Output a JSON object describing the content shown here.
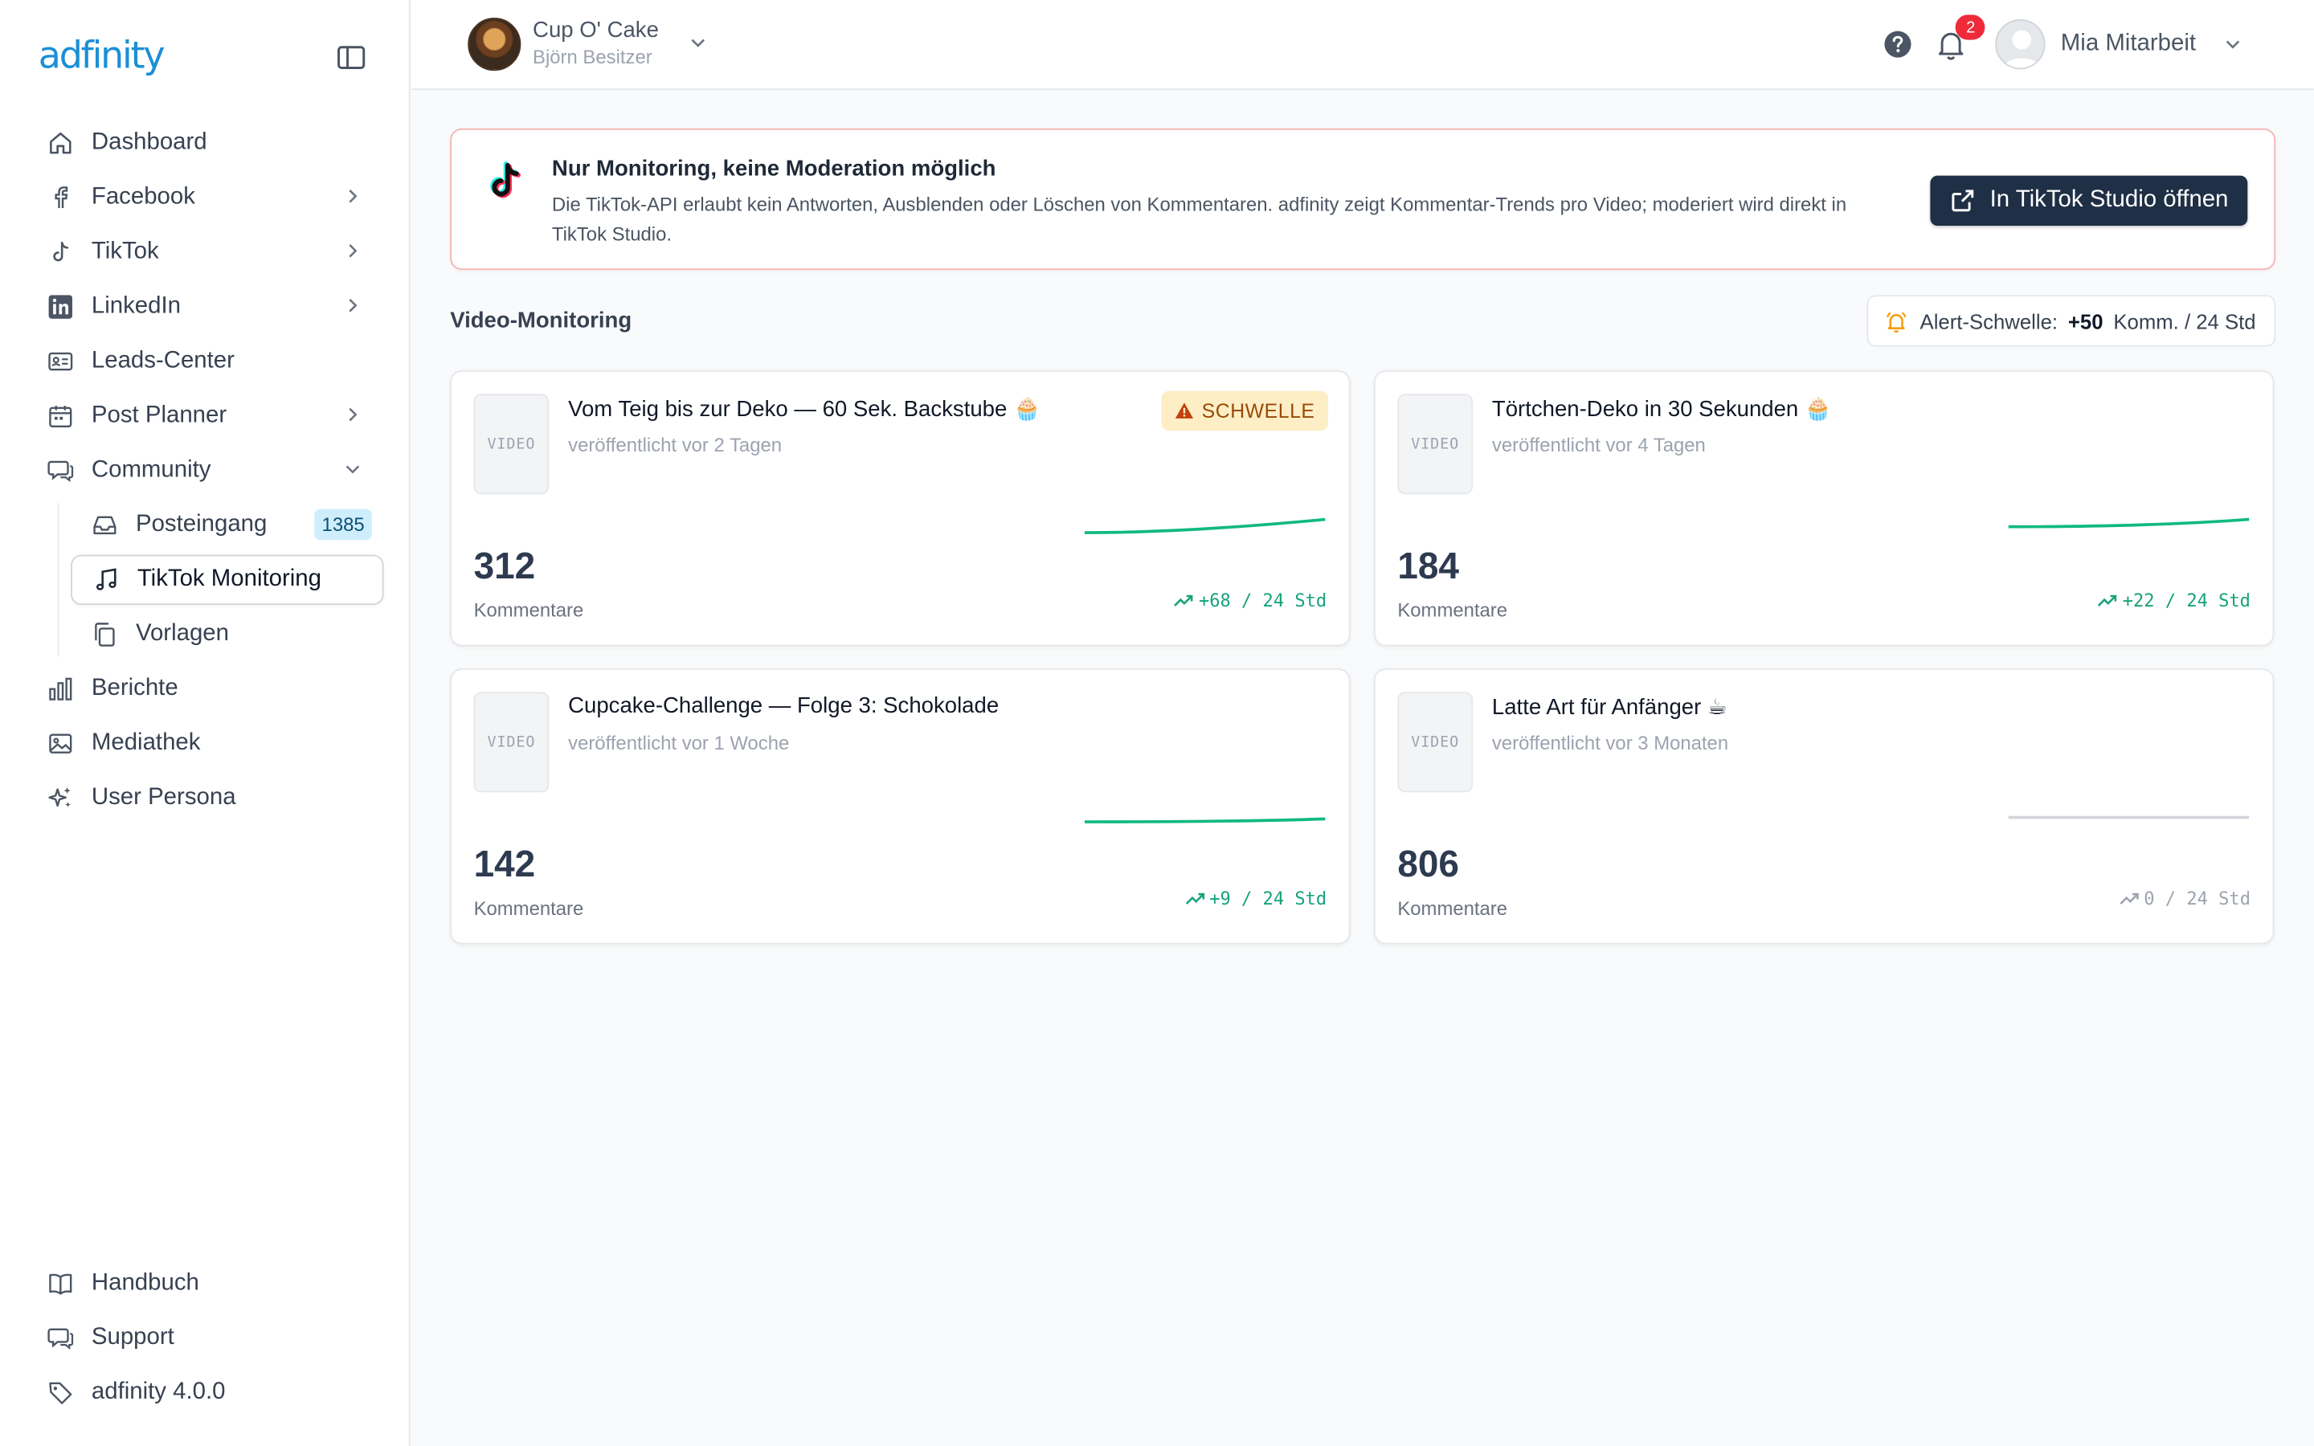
{
  "brand": {
    "logo_text": "adfinity"
  },
  "sidebar": {
    "items": [
      {
        "label": "Dashboard",
        "icon": "home-icon"
      },
      {
        "label": "Facebook",
        "icon": "facebook-icon"
      },
      {
        "label": "TikTok",
        "icon": "tiktok-icon"
      },
      {
        "label": "LinkedIn",
        "icon": "linkedin-icon"
      },
      {
        "label": "Leads-Center",
        "icon": "id-card-icon"
      },
      {
        "label": "Post Planner",
        "icon": "calendar-icon"
      },
      {
        "label": "Community",
        "icon": "chat-icon"
      }
    ],
    "community_sub": [
      {
        "label": "Posteingang",
        "icon": "inbox-icon",
        "count": "1385"
      },
      {
        "label": "TikTok Monitoring",
        "icon": "music-note-icon"
      },
      {
        "label": "Vorlagen",
        "icon": "copy-icon"
      }
    ],
    "items_after": [
      {
        "label": "Berichte",
        "icon": "bar-chart-icon"
      },
      {
        "label": "Mediathek",
        "icon": "image-icon"
      },
      {
        "label": "User Persona",
        "icon": "sparkles-icon"
      }
    ],
    "bottom": [
      {
        "label": "Handbuch",
        "icon": "book-icon"
      },
      {
        "label": "Support",
        "icon": "support-chat-icon"
      },
      {
        "label": "adfinity 4.0.0",
        "icon": "tag-icon"
      }
    ]
  },
  "header": {
    "account_name": "Cup O' Cake",
    "account_owner": "Björn Besitzer",
    "notification_count": "2",
    "user_name": "Mia Mitarbeit"
  },
  "banner": {
    "title": "Nur Monitoring, keine Moderation möglich",
    "text": "Die TikTok-API erlaubt kein Antworten, Ausblenden oder Löschen von Kommentaren. adfinity zeigt Kommentar-Trends pro Video; moderiert wird direkt in TikTok Studio.",
    "button_label": "In TikTok Studio öffnen"
  },
  "monitoring": {
    "section_title": "Video-Monitoring",
    "alert_label": "Alert-Schwelle:",
    "alert_value": "+50",
    "alert_unit": "Komm. / 24 Std"
  },
  "videos": [
    {
      "thumb_label": "VIDEO",
      "title": "Vom Teig bis zur Deko — 60 Sek. Backstube 🧁",
      "published": "veröffentlicht vor 2 Tagen",
      "comments": "312",
      "comments_label": "Kommentare",
      "trend": "+68 / 24 Std",
      "threshold_label": "SCHWELLE",
      "trend_color": "#16a37a",
      "spark_color": "#10b981"
    },
    {
      "thumb_label": "VIDEO",
      "title": "Törtchen-Deko in 30 Sekunden 🧁",
      "published": "veröffentlicht vor 4 Tagen",
      "comments": "184",
      "comments_label": "Kommentare",
      "trend": "+22 / 24 Std",
      "trend_color": "#16a37a",
      "spark_color": "#10b981"
    },
    {
      "thumb_label": "VIDEO",
      "title": "Cupcake-Challenge — Folge 3: Schokolade",
      "published": "veröffentlicht vor 1 Woche",
      "comments": "142",
      "comments_label": "Kommentare",
      "trend": "+9 / 24 Std",
      "trend_color": "#16a37a",
      "spark_color": "#10b981"
    },
    {
      "thumb_label": "VIDEO",
      "title": "Latte Art für Anfänger ☕",
      "published": "veröffentlicht vor 3 Monaten",
      "comments": "806",
      "comments_label": "Kommentare",
      "trend": "0 / 24 Std",
      "trend_color": "#9ca3af",
      "spark_color": "#d1d5db"
    }
  ]
}
